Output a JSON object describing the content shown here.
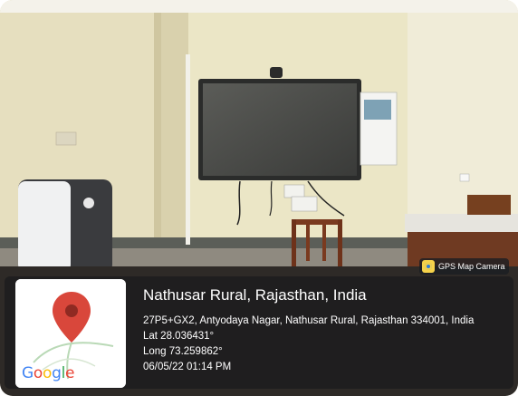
{
  "badge": {
    "icon": "gps-map-camera-icon",
    "label": "GPS Map Camera"
  },
  "map": {
    "logo_letters": [
      "G",
      "o",
      "o",
      "g",
      "l",
      "e"
    ],
    "logo_colors": [
      "#4285F4",
      "#EA4335",
      "#FBBC05",
      "#4285F4",
      "#34A853",
      "#EA4335"
    ],
    "pin_color": "#D9473B",
    "pin_icon": "map-pin-icon"
  },
  "location": {
    "title": "Nathusar Rural, Rajasthan, India",
    "address": "27P5+GX2, Antyodaya Nagar, Nathusar Rural, Rajasthan 334001, India",
    "lat": "Lat 28.036431°",
    "long": "Long 73.259862°",
    "datetime": "06/05/22 01:14 PM"
  }
}
